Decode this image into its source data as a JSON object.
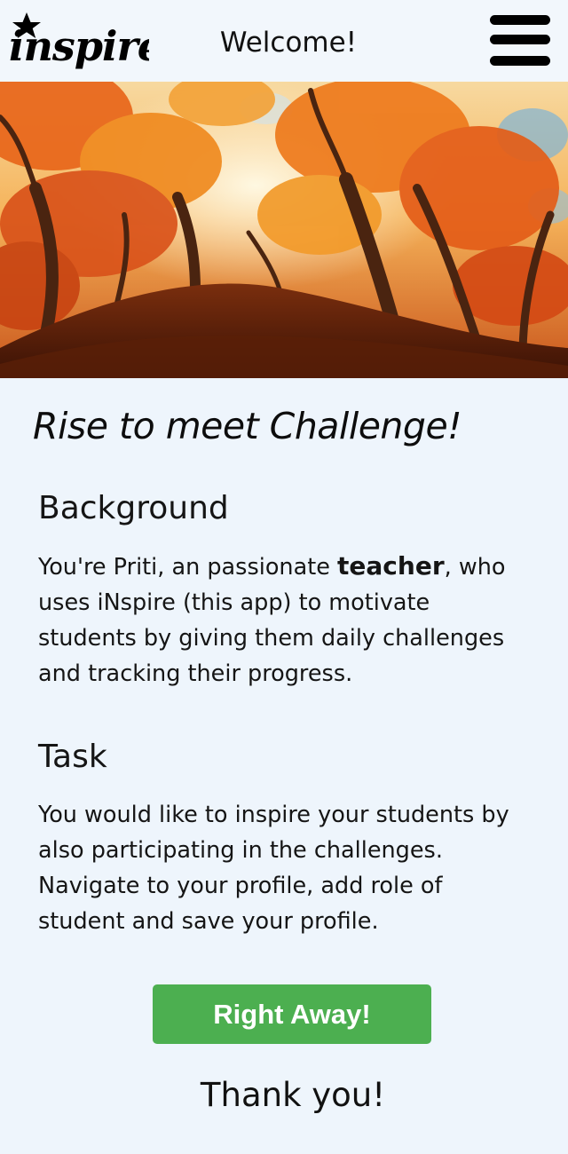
{
  "header": {
    "logo_text": "inspire",
    "welcome": "Welcome!",
    "menu_icon": "hamburger-menu-icon"
  },
  "hero": {
    "description": "autumn-forest-image"
  },
  "main": {
    "headline": "Rise to meet Challenge!",
    "background": {
      "title": "Background",
      "text_before": "You're Priti, an passionate ",
      "emphasis": "teacher",
      "text_after": ", who uses iNspire (this app) to motivate students by giving them daily challenges and tracking their progress."
    },
    "task": {
      "title": "Task",
      "text": "You would like to inspire your students by also participating in the challenges. Navigate to your profile, add role of student and save your profile."
    },
    "cta_label": "Right Away!",
    "thanks": "Thank you!"
  },
  "colors": {
    "page_bg": "#eef5fc",
    "cta_bg": "#4caf50",
    "cta_text": "#ffffff"
  }
}
